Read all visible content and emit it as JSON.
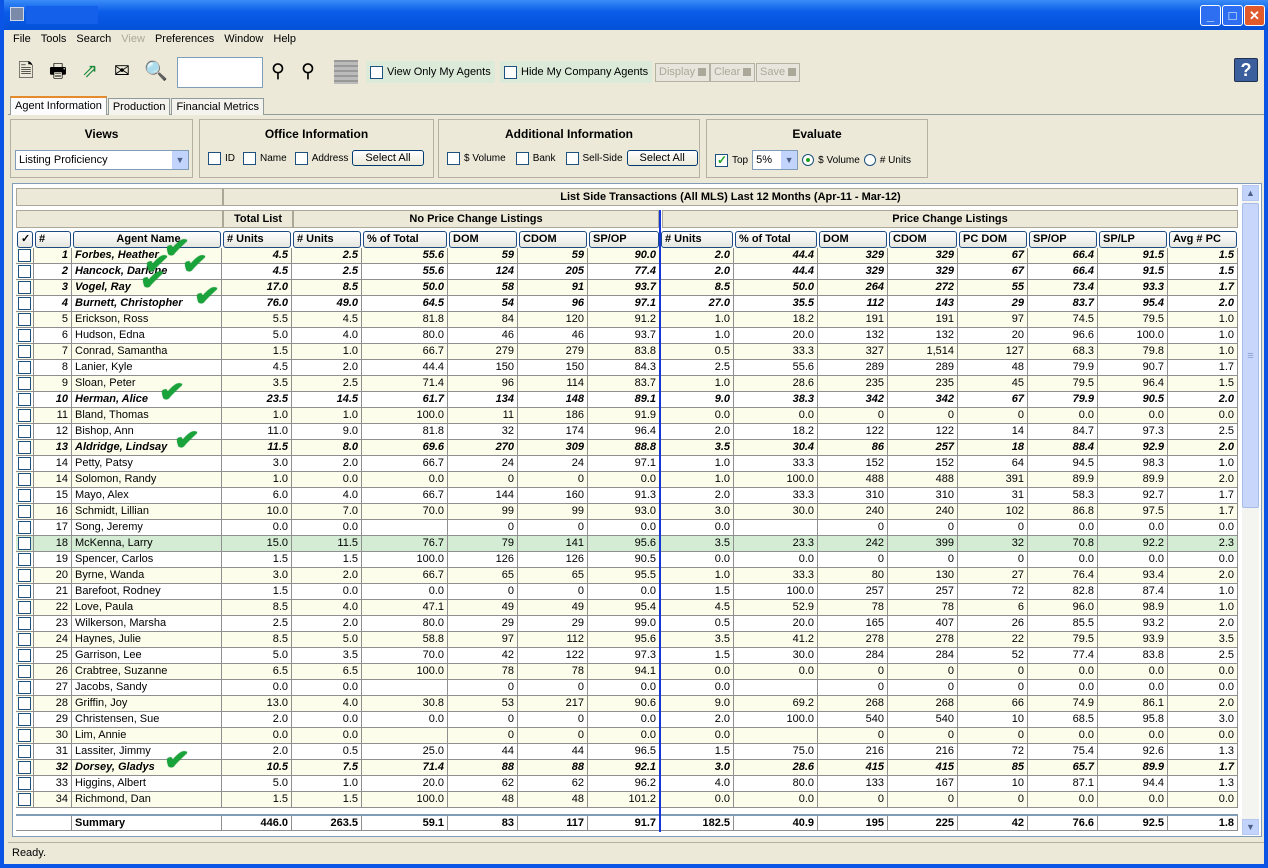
{
  "window": {
    "controls": [
      "_",
      "□",
      "✕"
    ]
  },
  "menu": [
    {
      "label": "File",
      "enabled": true
    },
    {
      "label": "Tools",
      "enabled": true
    },
    {
      "label": "Search",
      "enabled": true
    },
    {
      "label": "View",
      "enabled": false
    },
    {
      "label": "Preferences",
      "enabled": true
    },
    {
      "label": "Window",
      "enabled": true
    },
    {
      "label": "Help",
      "enabled": true
    }
  ],
  "toolbar": {
    "search_value": "",
    "view_only_my_agents": "View Only My Agents",
    "hide_my_company_agents": "Hide My Company Agents",
    "display": "Display",
    "clear": "Clear",
    "save": "Save",
    "help": "?"
  },
  "tabs": [
    {
      "label": "Agent Information",
      "active": true
    },
    {
      "label": "Production",
      "active": false
    },
    {
      "label": "Financial Metrics",
      "active": false
    }
  ],
  "views": {
    "title": "Views",
    "selected": "Listing Proficiency"
  },
  "office": {
    "title": "Office Information",
    "id": "ID",
    "name": "Name",
    "address": "Address",
    "select_all": "Select All"
  },
  "additional": {
    "title": "Additional Information",
    "volume": "$ Volume",
    "bank": "Bank",
    "sell_side": "Sell-Side",
    "select_all": "Select All"
  },
  "evaluate": {
    "title": "Evaluate",
    "top": "Top",
    "top_checked": true,
    "top_value": "5%",
    "volume": "$ Volume",
    "units": "# Units",
    "selected": "$ Volume"
  },
  "table": {
    "title": "List Side Transactions (All MLS) Last 12 Months (Apr-11 - Mar-12)",
    "group_total": "Total List",
    "group_npc": "No Price Change Listings",
    "group_pc": "Price Change Listings",
    "columns": [
      "✓",
      "#",
      "Agent Name",
      "# Units",
      "# Units",
      "% of Total",
      "DOM",
      "CDOM",
      "SP/OP",
      "# Units",
      "% of Total",
      "DOM",
      "CDOM",
      "PC DOM",
      "SP/OP",
      "SP/LP",
      "Avg # PC"
    ],
    "rows": [
      {
        "bold": true,
        "check": true,
        "v": [
          "1",
          "Forbes, Heather",
          "4.5",
          "2.5",
          "55.6",
          "59",
          "59",
          "90.0",
          "2.0",
          "44.4",
          "329",
          "329",
          "67",
          "66.4",
          "91.5",
          "1.5"
        ]
      },
      {
        "bold": true,
        "check": true,
        "v": [
          "2",
          "Hancock, Darlene",
          "4.5",
          "2.5",
          "55.6",
          "124",
          "205",
          "77.4",
          "2.0",
          "44.4",
          "329",
          "329",
          "67",
          "66.4",
          "91.5",
          "1.5"
        ]
      },
      {
        "bold": true,
        "check": true,
        "v": [
          "3",
          "Vogel, Ray",
          "17.0",
          "8.5",
          "50.0",
          "58",
          "91",
          "93.7",
          "8.5",
          "50.0",
          "264",
          "272",
          "55",
          "73.4",
          "93.3",
          "1.7"
        ]
      },
      {
        "bold": true,
        "check": true,
        "v": [
          "4",
          "Burnett, Christopher",
          "76.0",
          "49.0",
          "64.5",
          "54",
          "96",
          "97.1",
          "27.0",
          "35.5",
          "112",
          "143",
          "29",
          "83.7",
          "95.4",
          "2.0"
        ]
      },
      {
        "v": [
          "5",
          "Erickson, Ross",
          "5.5",
          "4.5",
          "81.8",
          "84",
          "120",
          "91.2",
          "1.0",
          "18.2",
          "191",
          "191",
          "97",
          "74.5",
          "79.5",
          "1.0"
        ]
      },
      {
        "v": [
          "6",
          "Hudson, Edna",
          "5.0",
          "4.0",
          "80.0",
          "46",
          "46",
          "93.7",
          "1.0",
          "20.0",
          "132",
          "132",
          "20",
          "96.6",
          "100.0",
          "1.0"
        ]
      },
      {
        "v": [
          "7",
          "Conrad, Samantha",
          "1.5",
          "1.0",
          "66.7",
          "279",
          "279",
          "83.8",
          "0.5",
          "33.3",
          "327",
          "1,514",
          "127",
          "68.3",
          "79.8",
          "1.0"
        ]
      },
      {
        "v": [
          "8",
          "Lanier, Kyle",
          "4.5",
          "2.0",
          "44.4",
          "150",
          "150",
          "84.3",
          "2.5",
          "55.6",
          "289",
          "289",
          "48",
          "79.9",
          "90.7",
          "1.7"
        ]
      },
      {
        "v": [
          "9",
          "Sloan, Peter",
          "3.5",
          "2.5",
          "71.4",
          "96",
          "114",
          "83.7",
          "1.0",
          "28.6",
          "235",
          "235",
          "45",
          "79.5",
          "96.4",
          "1.5"
        ]
      },
      {
        "bold": true,
        "check": true,
        "v": [
          "10",
          "Herman, Alice",
          "23.5",
          "14.5",
          "61.7",
          "134",
          "148",
          "89.1",
          "9.0",
          "38.3",
          "342",
          "342",
          "67",
          "79.9",
          "90.5",
          "2.0"
        ]
      },
      {
        "v": [
          "11",
          "Bland, Thomas",
          "1.0",
          "1.0",
          "100.0",
          "11",
          "186",
          "91.9",
          "0.0",
          "0.0",
          "0",
          "0",
          "0",
          "0.0",
          "0.0",
          "0.0"
        ]
      },
      {
        "v": [
          "12",
          "Bishop, Ann",
          "11.0",
          "9.0",
          "81.8",
          "32",
          "174",
          "96.4",
          "2.0",
          "18.2",
          "122",
          "122",
          "14",
          "84.7",
          "97.3",
          "2.5"
        ]
      },
      {
        "bold": true,
        "check": true,
        "v": [
          "13",
          "Aldridge, Lindsay",
          "11.5",
          "8.0",
          "69.6",
          "270",
          "309",
          "88.8",
          "3.5",
          "30.4",
          "86",
          "257",
          "18",
          "88.4",
          "92.9",
          "2.0"
        ]
      },
      {
        "v": [
          "14",
          "Petty, Patsy",
          "3.0",
          "2.0",
          "66.7",
          "24",
          "24",
          "97.1",
          "1.0",
          "33.3",
          "152",
          "152",
          "64",
          "94.5",
          "98.3",
          "1.0"
        ]
      },
      {
        "v": [
          "14",
          "Solomon, Randy",
          "1.0",
          "0.0",
          "0.0",
          "0",
          "0",
          "0.0",
          "1.0",
          "100.0",
          "488",
          "488",
          "391",
          "89.9",
          "89.9",
          "2.0"
        ]
      },
      {
        "v": [
          "15",
          "Mayo, Alex",
          "6.0",
          "4.0",
          "66.7",
          "144",
          "160",
          "91.3",
          "2.0",
          "33.3",
          "310",
          "310",
          "31",
          "58.3",
          "92.7",
          "1.7"
        ]
      },
      {
        "v": [
          "16",
          "Schmidt, Lillian",
          "10.0",
          "7.0",
          "70.0",
          "99",
          "99",
          "93.0",
          "3.0",
          "30.0",
          "240",
          "240",
          "102",
          "86.8",
          "97.5",
          "1.7"
        ]
      },
      {
        "v": [
          "17",
          "Song, Jeremy",
          "0.0",
          "0.0",
          "",
          "0",
          "0",
          "0.0",
          "0.0",
          "",
          "0",
          "0",
          "0",
          "0.0",
          "0.0",
          "0.0"
        ]
      },
      {
        "selected": true,
        "v": [
          "18",
          "McKenna, Larry",
          "15.0",
          "11.5",
          "76.7",
          "79",
          "141",
          "95.6",
          "3.5",
          "23.3",
          "242",
          "399",
          "32",
          "70.8",
          "92.2",
          "2.3"
        ]
      },
      {
        "v": [
          "19",
          "Spencer, Carlos",
          "1.5",
          "1.5",
          "100.0",
          "126",
          "126",
          "90.5",
          "0.0",
          "0.0",
          "0",
          "0",
          "0",
          "0.0",
          "0.0",
          "0.0"
        ]
      },
      {
        "v": [
          "20",
          "Byrne, Wanda",
          "3.0",
          "2.0",
          "66.7",
          "65",
          "65",
          "95.5",
          "1.0",
          "33.3",
          "80",
          "130",
          "27",
          "76.4",
          "93.4",
          "2.0"
        ]
      },
      {
        "v": [
          "21",
          "Barefoot, Rodney",
          "1.5",
          "0.0",
          "0.0",
          "0",
          "0",
          "0.0",
          "1.5",
          "100.0",
          "257",
          "257",
          "72",
          "82.8",
          "87.4",
          "1.0"
        ]
      },
      {
        "v": [
          "22",
          "Love, Paula",
          "8.5",
          "4.0",
          "47.1",
          "49",
          "49",
          "95.4",
          "4.5",
          "52.9",
          "78",
          "78",
          "6",
          "96.0",
          "98.9",
          "1.0"
        ]
      },
      {
        "v": [
          "23",
          "Wilkerson, Marsha",
          "2.5",
          "2.0",
          "80.0",
          "29",
          "29",
          "99.0",
          "0.5",
          "20.0",
          "165",
          "407",
          "26",
          "85.5",
          "93.2",
          "2.0"
        ]
      },
      {
        "v": [
          "24",
          "Haynes, Julie",
          "8.5",
          "5.0",
          "58.8",
          "97",
          "112",
          "95.6",
          "3.5",
          "41.2",
          "278",
          "278",
          "22",
          "79.5",
          "93.9",
          "3.5"
        ]
      },
      {
        "v": [
          "25",
          "Garrison, Lee",
          "5.0",
          "3.5",
          "70.0",
          "42",
          "122",
          "97.3",
          "1.5",
          "30.0",
          "284",
          "284",
          "52",
          "77.4",
          "83.8",
          "2.5"
        ]
      },
      {
        "v": [
          "26",
          "Crabtree, Suzanne",
          "6.5",
          "6.5",
          "100.0",
          "78",
          "78",
          "94.1",
          "0.0",
          "0.0",
          "0",
          "0",
          "0",
          "0.0",
          "0.0",
          "0.0"
        ]
      },
      {
        "v": [
          "27",
          "Jacobs, Sandy",
          "0.0",
          "0.0",
          "",
          "0",
          "0",
          "0.0",
          "0.0",
          "",
          "0",
          "0",
          "0",
          "0.0",
          "0.0",
          "0.0"
        ]
      },
      {
        "v": [
          "28",
          "Griffin, Joy",
          "13.0",
          "4.0",
          "30.8",
          "53",
          "217",
          "90.6",
          "9.0",
          "69.2",
          "268",
          "268",
          "66",
          "74.9",
          "86.1",
          "2.0"
        ]
      },
      {
        "v": [
          "29",
          "Christensen, Sue",
          "2.0",
          "0.0",
          "0.0",
          "0",
          "0",
          "0.0",
          "2.0",
          "100.0",
          "540",
          "540",
          "10",
          "68.5",
          "95.8",
          "3.0"
        ]
      },
      {
        "v": [
          "30",
          "Lim, Annie",
          "0.0",
          "0.0",
          "",
          "0",
          "0",
          "0.0",
          "0.0",
          "",
          "0",
          "0",
          "0",
          "0.0",
          "0.0",
          "0.0"
        ]
      },
      {
        "v": [
          "31",
          "Lassiter, Jimmy",
          "2.0",
          "0.5",
          "25.0",
          "44",
          "44",
          "96.5",
          "1.5",
          "75.0",
          "216",
          "216",
          "72",
          "75.4",
          "92.6",
          "1.3"
        ]
      },
      {
        "bold": true,
        "check": true,
        "v": [
          "32",
          "Dorsey, Gladys",
          "10.5",
          "7.5",
          "71.4",
          "88",
          "88",
          "92.1",
          "3.0",
          "28.6",
          "415",
          "415",
          "85",
          "65.7",
          "89.9",
          "1.7"
        ]
      },
      {
        "v": [
          "33",
          "Higgins, Albert",
          "5.0",
          "1.0",
          "20.0",
          "62",
          "62",
          "96.2",
          "4.0",
          "80.0",
          "133",
          "167",
          "10",
          "87.1",
          "94.4",
          "1.3"
        ]
      },
      {
        "v": [
          "34",
          "Richmond, Dan",
          "1.5",
          "1.5",
          "100.0",
          "48",
          "48",
          "101.2",
          "0.0",
          "0.0",
          "0",
          "0",
          "0",
          "0.0",
          "0.0",
          "0.0"
        ]
      }
    ],
    "summary": {
      "label": "Summary",
      "v": [
        "446.0",
        "263.5",
        "59.1",
        "83",
        "117",
        "91.7",
        "182.5",
        "40.9",
        "195",
        "225",
        "42",
        "76.6",
        "92.5",
        "1.8"
      ]
    }
  },
  "status": "Ready.",
  "colors": {
    "titlebar": "#0a5ce8",
    "selected_row": "#d4ecd4",
    "alt_row": "#fdfdec",
    "checkmark": "#1aa33a",
    "divider": "#1436d8"
  }
}
